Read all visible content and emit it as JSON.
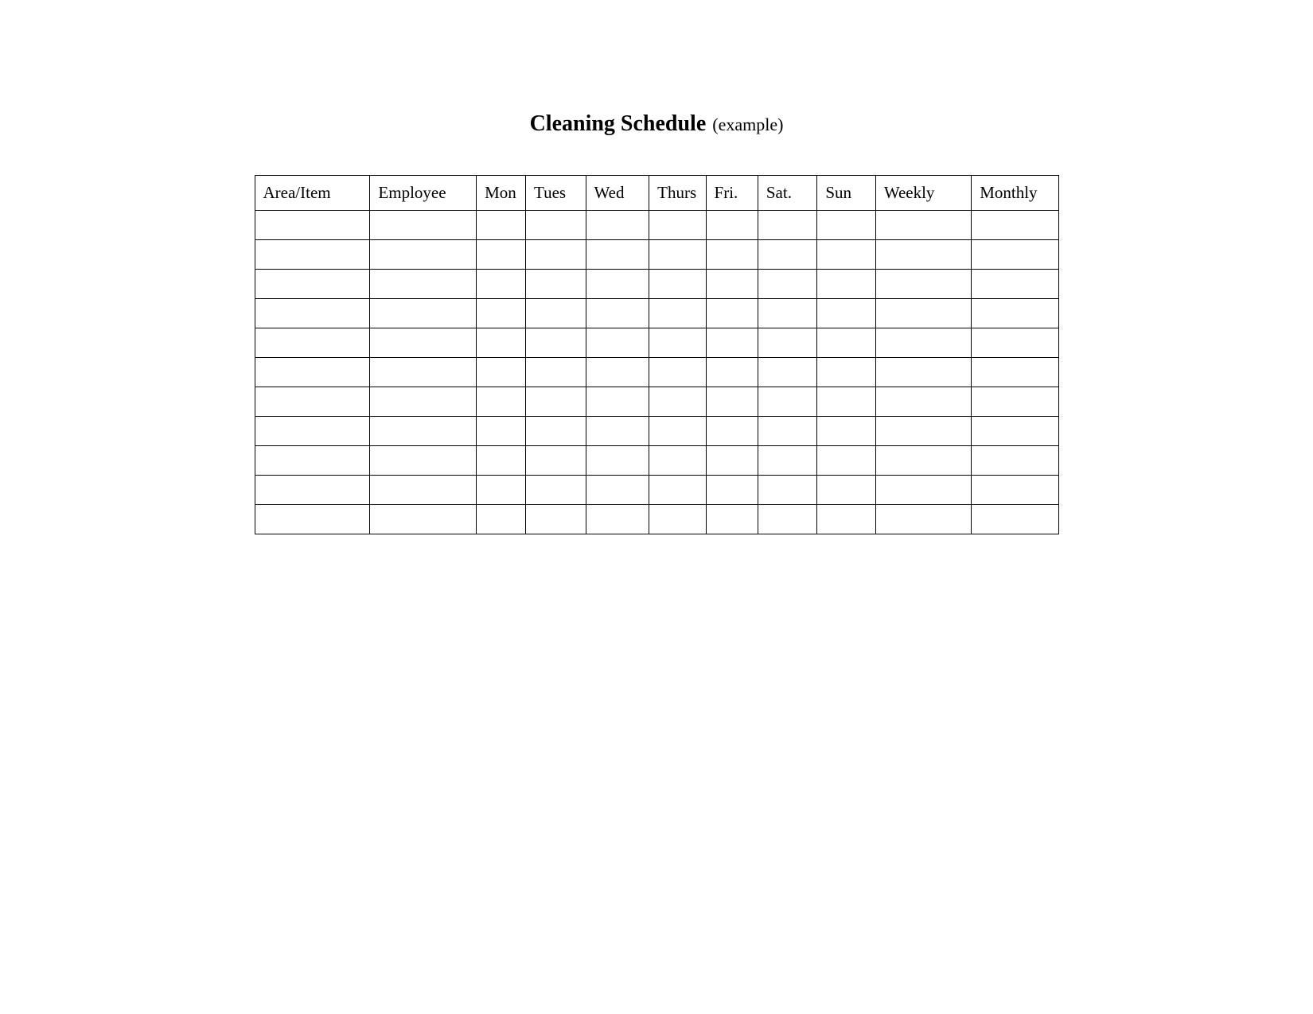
{
  "title": "Cleaning Schedule",
  "subtitle": "(example)",
  "table": {
    "headers": [
      "Area/Item",
      "Employee",
      "Mon",
      "Tues",
      "Wed",
      "Thurs",
      "Fri.",
      "Sat.",
      "Sun",
      "Weekly",
      "Monthly"
    ],
    "rows": [
      [
        "",
        "",
        "",
        "",
        "",
        "",
        "",
        "",
        "",
        "",
        ""
      ],
      [
        "",
        "",
        "",
        "",
        "",
        "",
        "",
        "",
        "",
        "",
        ""
      ],
      [
        "",
        "",
        "",
        "",
        "",
        "",
        "",
        "",
        "",
        "",
        ""
      ],
      [
        "",
        "",
        "",
        "",
        "",
        "",
        "",
        "",
        "",
        "",
        ""
      ],
      [
        "",
        "",
        "",
        "",
        "",
        "",
        "",
        "",
        "",
        "",
        ""
      ],
      [
        "",
        "",
        "",
        "",
        "",
        "",
        "",
        "",
        "",
        "",
        ""
      ],
      [
        "",
        "",
        "",
        "",
        "",
        "",
        "",
        "",
        "",
        "",
        ""
      ],
      [
        "",
        "",
        "",
        "",
        "",
        "",
        "",
        "",
        "",
        "",
        ""
      ],
      [
        "",
        "",
        "",
        "",
        "",
        "",
        "",
        "",
        "",
        "",
        ""
      ],
      [
        "",
        "",
        "",
        "",
        "",
        "",
        "",
        "",
        "",
        "",
        ""
      ],
      [
        "",
        "",
        "",
        "",
        "",
        "",
        "",
        "",
        "",
        "",
        ""
      ]
    ]
  }
}
